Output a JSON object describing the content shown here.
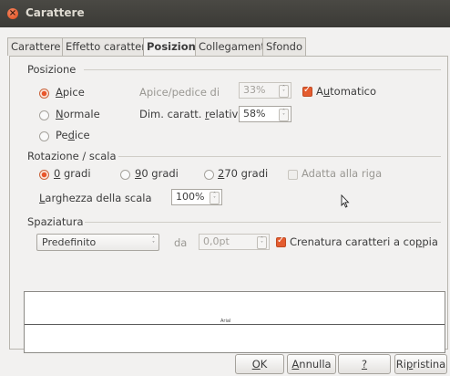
{
  "window": {
    "title": "Carattere",
    "close_glyph": "×"
  },
  "tabs": [
    {
      "label": "Carattere",
      "active": false
    },
    {
      "label": "Effetto carattere",
      "active": false
    },
    {
      "label": "Posizione",
      "active": true
    },
    {
      "label": "Collegamento",
      "active": false
    },
    {
      "label": "Sfondo",
      "active": false
    }
  ],
  "posizione": {
    "heading": "Posizione",
    "options": [
      {
        "label_pre": "",
        "label_acc": "A",
        "label_post": "pice",
        "checked": true
      },
      {
        "label_pre": "",
        "label_acc": "N",
        "label_post": "ormale",
        "checked": false
      },
      {
        "label_pre": "Pe",
        "label_acc": "d",
        "label_post": "ice",
        "checked": false
      }
    ],
    "apice_pedice_label": "Apice/pedice di",
    "apice_pedice_value": "33%",
    "automatico_pre": "A",
    "automatico_acc": "u",
    "automatico_post": "tomatico",
    "automatico_checked": true,
    "dim_label_pre": "Dim. caratt. ",
    "dim_label_acc": "r",
    "dim_label_post": "elativa",
    "dim_value": "58%"
  },
  "rotazione": {
    "heading": "Rotazione / scala",
    "options": [
      {
        "label_acc": "0",
        "label_post": " gradi",
        "checked": true
      },
      {
        "label_acc": "9",
        "label_post": "0 gradi",
        "checked": false
      },
      {
        "label_acc": "2",
        "label_post": "70 gradi",
        "checked": false
      }
    ],
    "adatta_label": "Adatta alla riga",
    "adatta_checked": false,
    "larghezza_label_acc": "L",
    "larghezza_label_post": "arghezza della scala",
    "larghezza_value": "100%"
  },
  "spaziatura": {
    "heading": "Spaziatura",
    "selected": "Predefinito",
    "da_label": "da",
    "da_value": "0,0pt",
    "crenatura_pre": "Crenatura caratteri a co",
    "crenatura_acc": "p",
    "crenatura_post": "pia",
    "crenatura_checked": true
  },
  "preview": {
    "text": "Arial"
  },
  "buttons": {
    "ok_acc": "O",
    "ok_post": "K",
    "annulla_acc": "A",
    "annulla_post": "nnulla",
    "help_acc": "?",
    "ripristina_pre": "Ri",
    "ripristina_acc": "p",
    "ripristina_post": "ristina"
  }
}
